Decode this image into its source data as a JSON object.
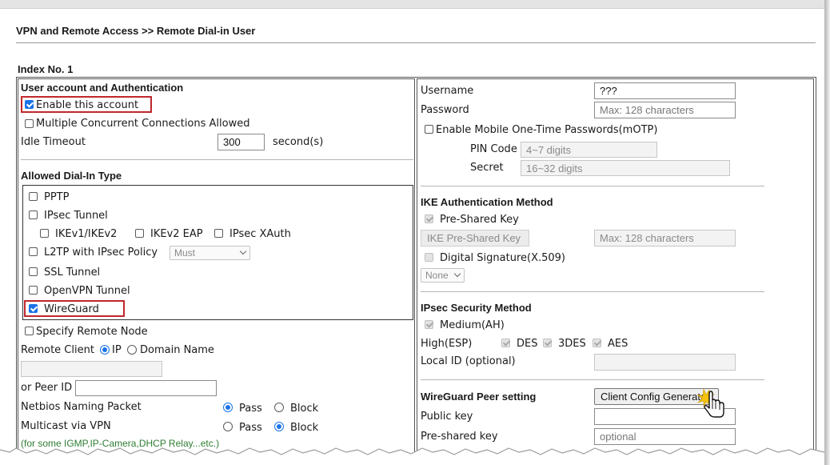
{
  "breadcrumb": "VPN and Remote Access >> Remote Dial-in User",
  "index_label": "Index No. 1",
  "left": {
    "auth_title": "User account and Authentication",
    "enable_account": {
      "label": "Enable this account",
      "checked": true
    },
    "multiple_connections": {
      "label": "Multiple Concurrent Connections Allowed",
      "checked": false
    },
    "idle_timeout": {
      "label": "Idle Timeout",
      "value": "300",
      "unit": "second(s)"
    },
    "dialin_title": "Allowed Dial-In Type",
    "pptp": "PPTP",
    "ipsec_tunnel": "IPsec Tunnel",
    "ikev1": "IKEv1/IKEv2",
    "ikev2_eap": "IKEv2 EAP",
    "ipsec_xauth": "IPsec XAuth",
    "l2tp": "L2TP with IPsec Policy",
    "l2tp_policy": "Must",
    "ssl_tunnel": "SSL Tunnel",
    "openvpn": "OpenVPN Tunnel",
    "wireguard": {
      "label": "WireGuard",
      "checked": true
    },
    "specify_remote": "Specify Remote Node",
    "remote_client_label": "Remote Client",
    "ip_option": "IP",
    "domain_option": "Domain Name",
    "peer_id_label": "or Peer ID",
    "netbios": {
      "label": "Netbios Naming Packet",
      "pass": "Pass",
      "block": "Block",
      "selected": "Pass"
    },
    "multicast": {
      "label": "Multicast via VPN",
      "pass": "Pass",
      "block": "Block",
      "selected": "Block"
    },
    "multicast_note": "(for some IGMP,IP-Camera,DHCP Relay...etc.)"
  },
  "right": {
    "username": {
      "label": "Username",
      "value": "???"
    },
    "password": {
      "label": "Password",
      "placeholder": "Max: 128 characters"
    },
    "motp": "Enable Mobile One-Time Passwords(mOTP)",
    "pin_code": {
      "label": "PIN Code",
      "placeholder": "4~7 digits"
    },
    "secret": {
      "label": "Secret",
      "placeholder": "16~32 digits"
    },
    "ike_title": "IKE Authentication Method",
    "pre_shared_key": "Pre-Shared Key",
    "ike_psk_button": "IKE Pre-Shared Key",
    "ike_psk_placeholder": "Max: 128 characters",
    "digital_signature": "Digital Signature(X.509)",
    "signature_select": "None",
    "ipsec_title": "IPsec Security Method",
    "medium_ah": "Medium(AH)",
    "high_esp": "High(ESP)",
    "des": "DES",
    "tdes": "3DES",
    "aes": "AES",
    "local_id": "Local ID (optional)",
    "wg_title": "WireGuard Peer setting",
    "client_config_button": "Client Config Generator",
    "public_key": "Public key",
    "pre_shared_key_label": "Pre-shared key",
    "psk_placeholder": "optional"
  },
  "colors": {
    "highlight": "#c0272d",
    "checkbox": "#1a73e8",
    "note": "#2e7d32"
  },
  "icons": {
    "cursor": "hand-pointer-icon"
  }
}
